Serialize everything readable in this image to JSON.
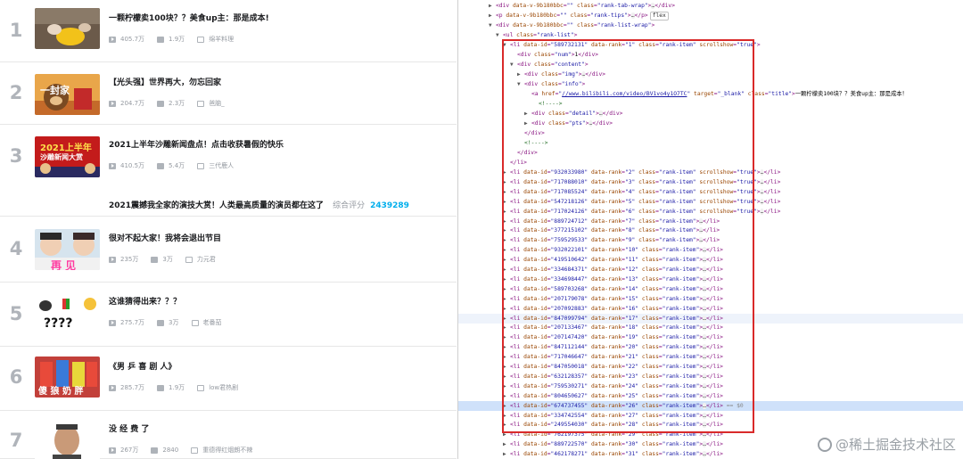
{
  "ranking": [
    {
      "num": "1",
      "title": "一颗柠檬卖100块？？美食up主：那是成本!",
      "views": "405.7万",
      "danmaku": "1.9万",
      "author": "绵羊料理"
    },
    {
      "num": "2",
      "title": "【光头强】世界再大，勿忘回家",
      "views": "204.7万",
      "danmaku": "2.3万",
      "author": "爸脑_"
    },
    {
      "num": "3",
      "title": "2021上半年沙雕新闻盘点！点击收获暑假的快乐",
      "views": "410.5万",
      "danmaku": "5.4万",
      "author": "三代鹿人"
    },
    {
      "num": "4",
      "title": "很对不起大家！我将会退出节目",
      "views": "235万",
      "danmaku": "3万",
      "author": "力元君"
    },
    {
      "num": "5",
      "title": "这谁猜得出来？？？",
      "views": "275.7万",
      "danmaku": "3万",
      "author": "老番茄"
    },
    {
      "num": "6",
      "title": "《男 乒 喜 剧 人》",
      "views": "285.7万",
      "danmaku": "1.9万",
      "author": "low君热剧"
    },
    {
      "num": "7",
      "title": "没 经 费 了",
      "views": "267万",
      "danmaku": "2840",
      "author": "重德得红烟朗不辣"
    }
  ],
  "thumb_texts": {
    "t2": "一封家",
    "t3a": "2021上半年",
    "t3b": "沙雕新闻大赏",
    "t4": "再  见",
    "t5": "????",
    "t6": "傻 狼 奶 胖"
  },
  "note": {
    "title": "2021震撼我全家的演技大赏！人类最高质量的演员都在这了",
    "label": "综合评分",
    "score": "2439289"
  },
  "devtools": {
    "pill": "flex",
    "href": "//www.bilibili.com/video/BV1vo4y1O7TC",
    "title_text": "一颗柠檬卖100块？？美食up主：那是成本！",
    "comment": "<!---->",
    "rows": [
      {
        "id": "932033980",
        "rank": "2",
        "show": true
      },
      {
        "id": "717088010",
        "rank": "3",
        "show": true
      },
      {
        "id": "717085524",
        "rank": "4",
        "show": true
      },
      {
        "id": "547218126",
        "rank": "5",
        "show": true
      },
      {
        "id": "717024126",
        "rank": "6",
        "show": true
      },
      {
        "id": "889724712",
        "rank": "7"
      },
      {
        "id": "377215102",
        "rank": "8"
      },
      {
        "id": "759529533",
        "rank": "9"
      },
      {
        "id": "932022101",
        "rank": "10"
      },
      {
        "id": "419510642",
        "rank": "11"
      },
      {
        "id": "334684371",
        "rank": "12"
      },
      {
        "id": "334698447",
        "rank": "13"
      },
      {
        "id": "589703268",
        "rank": "14"
      },
      {
        "id": "207179078",
        "rank": "15"
      },
      {
        "id": "207092883",
        "rank": "16"
      },
      {
        "id": "847099794",
        "rank": "17"
      },
      {
        "id": "207133467",
        "rank": "18"
      },
      {
        "id": "207147420",
        "rank": "19"
      },
      {
        "id": "847112144",
        "rank": "20"
      },
      {
        "id": "717046647",
        "rank": "21"
      },
      {
        "id": "847050018",
        "rank": "22"
      },
      {
        "id": "632128357",
        "rank": "23"
      },
      {
        "id": "759530271",
        "rank": "24"
      },
      {
        "id": "804650627",
        "rank": "25"
      },
      {
        "id": "674737455",
        "rank": "26",
        "eq": "== $0"
      },
      {
        "id": "334742554",
        "rank": "27"
      },
      {
        "id": "249554030",
        "rank": "28"
      },
      {
        "id": "762197375",
        "rank": "29"
      },
      {
        "id": "889722570",
        "rank": "30"
      },
      {
        "id": "462178271",
        "rank": "31"
      }
    ]
  },
  "watermark": "@稀土掘金技术社区",
  "colors": {
    "accent": "#00aeec",
    "red_box": "#d92a2a",
    "rank_gray": "#b0b4ba"
  }
}
